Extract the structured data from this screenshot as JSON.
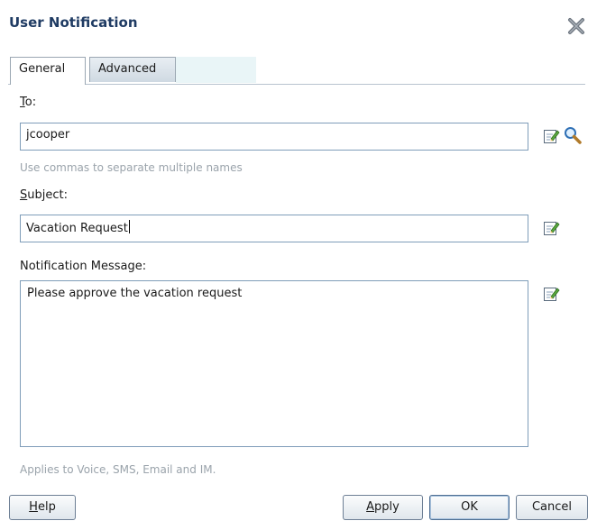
{
  "dialog": {
    "title": "User Notification"
  },
  "tabs": {
    "general": "General",
    "advanced": "Advanced"
  },
  "to": {
    "label_accel": "T",
    "label_rest": "o:",
    "value": "jcooper",
    "hint": "Use commas to separate multiple names"
  },
  "subject": {
    "label_accel": "S",
    "label_rest": "ubject:",
    "value": "Vacation Request"
  },
  "message": {
    "label": "Notification Message:",
    "value": "Please approve the vacation request",
    "hint": "Applies to Voice, SMS, Email and IM."
  },
  "buttons": {
    "help_accel": "H",
    "help_rest": "elp",
    "apply_accel": "A",
    "apply_rest": "pply",
    "ok": "OK",
    "cancel": "Cancel"
  },
  "icons": {
    "edit": "edit-expression-icon",
    "search": "search-icon",
    "close": "close-icon"
  },
  "colors": {
    "title": "#1f3b63",
    "hint": "#9aa3ab",
    "field_border": "#7f9db9"
  }
}
